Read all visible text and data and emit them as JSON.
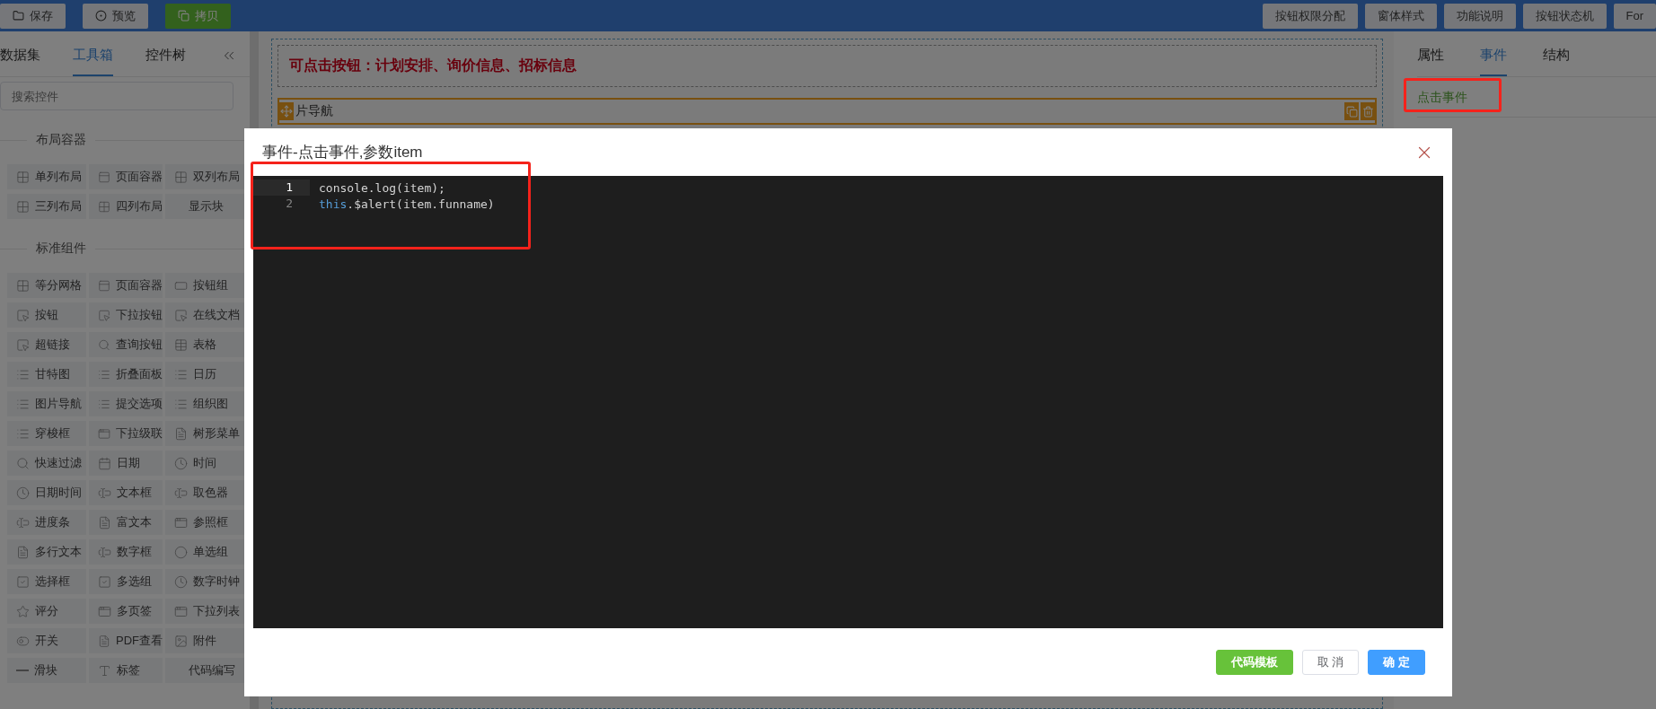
{
  "toolbar": {
    "left_buttons": [
      {
        "label": "保存",
        "kind": "plain"
      },
      {
        "label": "预览",
        "kind": "plain"
      },
      {
        "label": "拷贝",
        "kind": "primary"
      }
    ],
    "right_buttons": [
      "按钮权限分配",
      "窗体样式",
      "功能说明",
      "按钮状态机",
      "For"
    ]
  },
  "sidebar": {
    "tabs": [
      {
        "label": "数据集",
        "selected": false
      },
      {
        "label": "工具箱",
        "selected": true
      },
      {
        "label": "控件树",
        "selected": false
      }
    ],
    "search": {
      "placeholder": "搜索控件"
    },
    "sections": [
      {
        "title": "布局容器",
        "items": [
          "单列布局",
          "页面容器",
          "双列布局",
          "三列布局",
          "四列布局",
          "显示块"
        ]
      },
      {
        "title": "标准组件",
        "items": [
          "等分网格",
          "页面容器",
          "按钮组",
          "按钮",
          "下拉按钮",
          "在线文档",
          "超链接",
          "查询按钮",
          "表格",
          "甘特图",
          "折叠面板",
          "日历",
          "图片导航",
          "提交选项",
          "组织图",
          "穿梭框",
          "下拉级联",
          "树形菜单",
          "快速过滤",
          "日期",
          "时间",
          "日期时间",
          "文本框",
          "取色器",
          "进度条",
          "富文本",
          "参照框",
          "多行文本",
          "数字框",
          "单选组",
          "选择框",
          "多选组",
          "数字时钟",
          "评分",
          "多页签",
          "下拉列表",
          "开关",
          "PDF查看",
          "附件",
          "滑块",
          "标签",
          "代码编写"
        ]
      }
    ]
  },
  "canvas": {
    "banner": "可点击按钮：计划安排、询价信息、招标信息",
    "nav_block": "片导航"
  },
  "right_panel": {
    "tabs": [
      {
        "label": "属性",
        "selected": false
      },
      {
        "label": "事件",
        "selected": true
      },
      {
        "label": "结构",
        "selected": false
      }
    ],
    "events": [
      "点击事件"
    ]
  },
  "dialog": {
    "title": "事件-点击事件,参数item",
    "code_lines": [
      {
        "number": "1",
        "active": true,
        "tokens": [
          {
            "kind": "plain",
            "text": "console.log(item);"
          }
        ]
      },
      {
        "number": "2",
        "active": false,
        "tokens": [
          {
            "kind": "keyword",
            "text": "this"
          },
          {
            "kind": "plain",
            "text": ".$alert(item.funname)"
          }
        ]
      }
    ],
    "buttons": [
      {
        "label": "代码模板",
        "kind": "success"
      },
      {
        "label": "取 消",
        "kind": "default"
      },
      {
        "label": "确 定",
        "kind": "primary"
      }
    ]
  }
}
